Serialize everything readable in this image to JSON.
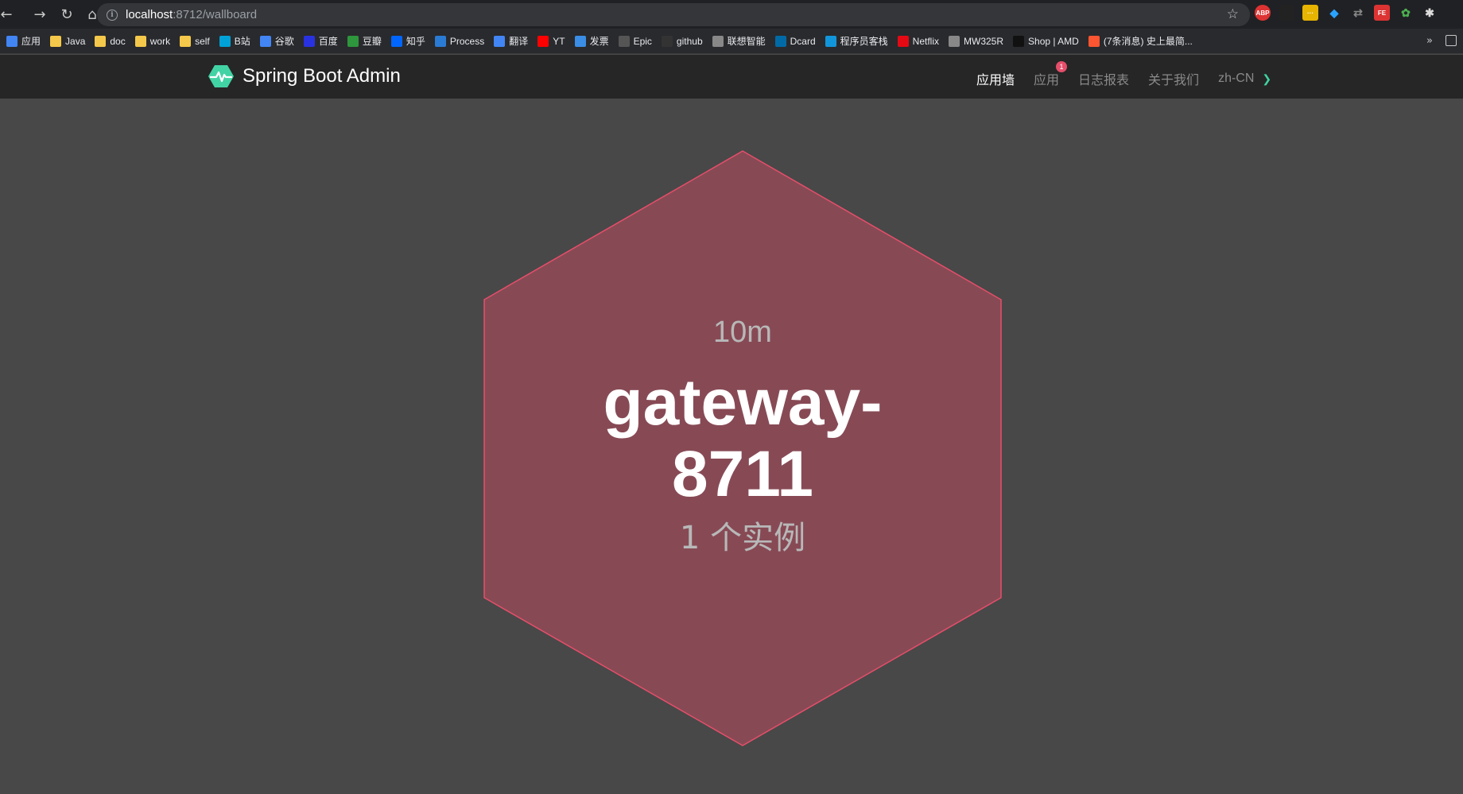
{
  "browser": {
    "url_host": "localhost",
    "url_path": ":8712/wallboard",
    "bookmarks": [
      {
        "label": "应用",
        "icon": "apps-grid-icon",
        "color": "#4285f4"
      },
      {
        "label": "Java",
        "icon": "folder-icon",
        "color": "#f4c84a"
      },
      {
        "label": "doc",
        "icon": "folder-icon",
        "color": "#f4c84a"
      },
      {
        "label": "work",
        "icon": "folder-icon",
        "color": "#f4c84a"
      },
      {
        "label": "self",
        "icon": "folder-icon",
        "color": "#f4c84a"
      },
      {
        "label": "B站",
        "icon": "bilibili-icon",
        "color": "#00a1d6"
      },
      {
        "label": "谷歌",
        "icon": "google-icon",
        "color": "#4285f4"
      },
      {
        "label": "百度",
        "icon": "baidu-icon",
        "color": "#2932e1"
      },
      {
        "label": "豆瓣",
        "icon": "douban-icon",
        "color": "#2e963d"
      },
      {
        "label": "知乎",
        "icon": "zhihu-icon",
        "color": "#0066ff"
      },
      {
        "label": "Process",
        "icon": "processon-icon",
        "color": "#2a7bd4"
      },
      {
        "label": "翻译",
        "icon": "translate-icon",
        "color": "#4285f4"
      },
      {
        "label": "YT",
        "icon": "youtube-icon",
        "color": "#ff0000"
      },
      {
        "label": "发票",
        "icon": "invoice-icon",
        "color": "#3a8ee6"
      },
      {
        "label": "Epic",
        "icon": "epic-icon",
        "color": "#555555"
      },
      {
        "label": "github",
        "icon": "github-icon",
        "color": "#333333"
      },
      {
        "label": "联想智能",
        "icon": "globe-icon",
        "color": "#888888"
      },
      {
        "label": "Dcard",
        "icon": "dcard-icon",
        "color": "#006aa6"
      },
      {
        "label": "程序员客栈",
        "icon": "terminal-icon",
        "color": "#1296db"
      },
      {
        "label": "Netflix",
        "icon": "netflix-icon",
        "color": "#e50914"
      },
      {
        "label": "MW325R",
        "icon": "globe-icon",
        "color": "#888888"
      },
      {
        "label": "Shop | AMD",
        "icon": "amd-icon",
        "color": "#111111"
      },
      {
        "label": "(7条消息) 史上最简...",
        "icon": "csdn-icon",
        "color": "#fc5531"
      }
    ],
    "more_label": "»"
  },
  "navbar": {
    "brand": "Spring Boot Admin",
    "items": [
      {
        "label": "应用墙",
        "active": true
      },
      {
        "label": "应用",
        "active": false,
        "badge": "1"
      },
      {
        "label": "日志报表",
        "active": false
      },
      {
        "label": "关于我们",
        "active": false
      }
    ],
    "language": "zh-CN"
  },
  "wallboard": {
    "application": {
      "since": "10m",
      "name": "gateway-8711",
      "instances": "1 个实例",
      "status_color": "#e64e6a"
    }
  }
}
